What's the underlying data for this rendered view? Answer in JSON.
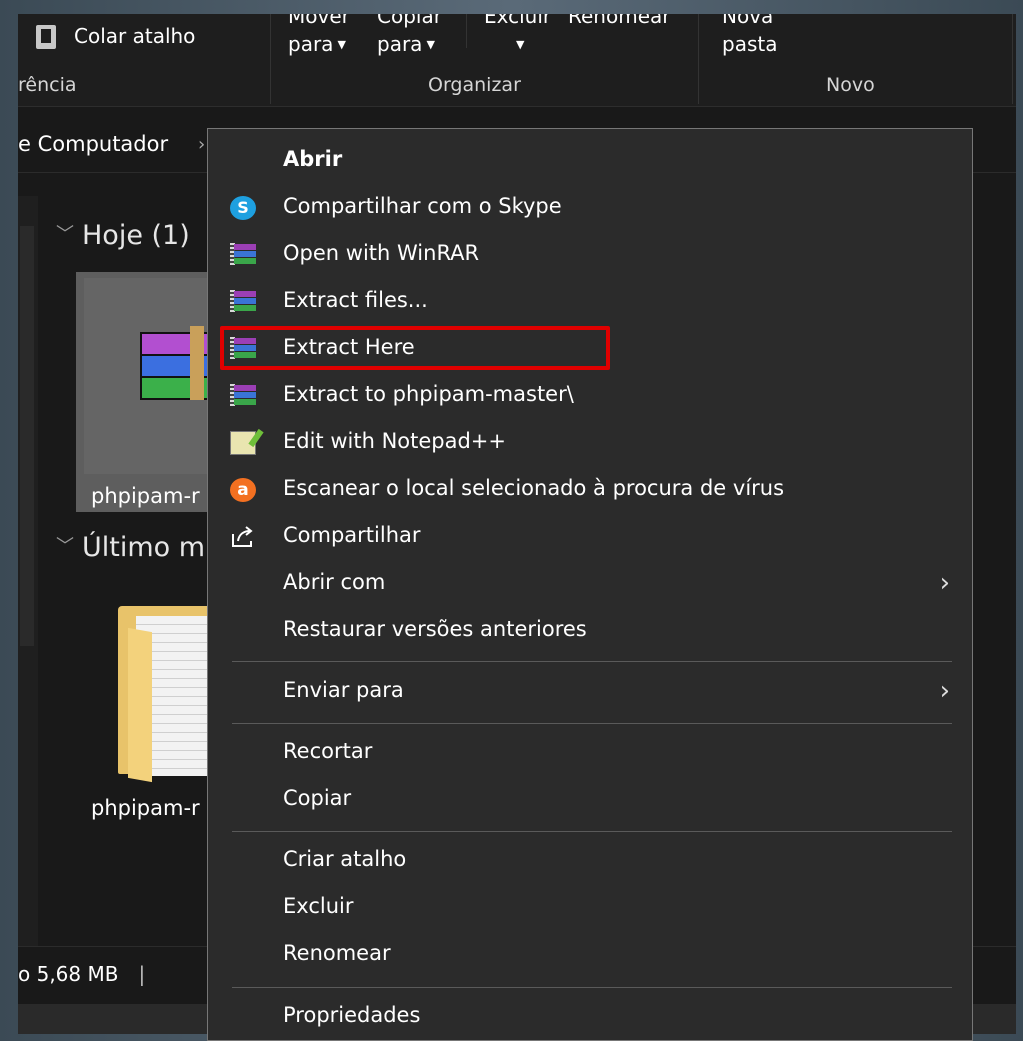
{
  "ribbon": {
    "paste_shortcut": "Colar atalho",
    "move_to_line1": "Mover",
    "move_to_line2": "para",
    "copy_to_line1": "Copiar",
    "copy_to_line2": "para",
    "delete": "Excluir",
    "rename": "Renomear",
    "new_folder_line1": "Nova",
    "new_folder_line2": "pasta",
    "group_clipboard": "rência",
    "group_organize": "Organizar",
    "group_new": "Novo"
  },
  "address": {
    "path": "e Computador"
  },
  "content": {
    "group_today": "Hoje (1)",
    "group_last": "Último m",
    "file_rar_label": "phpipam-r",
    "file_folder_label": "phpipam-r"
  },
  "status": {
    "size_text": "o 5,68 MB"
  },
  "menu": {
    "open": "Abrir",
    "share_skype": "Compartilhar com o Skype",
    "open_winrar": "Open with WinRAR",
    "extract_files": "Extract files...",
    "extract_here": "Extract Here",
    "extract_to": "Extract to phpipam-master\\",
    "edit_notepad": "Edit with Notepad++",
    "scan_virus": "Escanear o local selecionado à procura de vírus",
    "share": "Compartilhar",
    "open_with": "Abrir com",
    "restore_versions": "Restaurar versões anteriores",
    "send_to": "Enviar para",
    "cut": "Recortar",
    "copy": "Copiar",
    "create_shortcut": "Criar atalho",
    "delete": "Excluir",
    "rename": "Renomear",
    "properties": "Propriedades",
    "submenu_arrow": "›",
    "highlight_color": "#e00000"
  },
  "icons": {
    "skype_letter": "S",
    "avast_letter": "a"
  }
}
